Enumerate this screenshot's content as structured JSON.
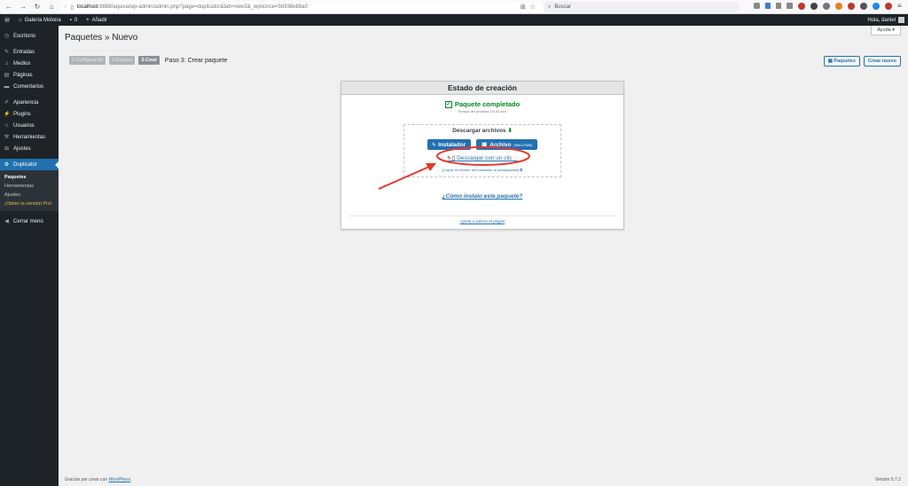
{
  "browser": {
    "url_host": "localhost",
    "url_path": ":8888/aquiva/wp-admin/admin.php?page=duplicator&tab=new3&_wpnonce=5b938eb9a0",
    "search_placeholder": "Buscar"
  },
  "adminbar": {
    "site_name": "Galería Molona",
    "comments_count": "0",
    "add_label": "Añadir",
    "greeting": "Hola, daniel"
  },
  "sidebar": {
    "items": [
      {
        "icon": "dashboard-icon",
        "label": "Escritorio"
      },
      {
        "icon": "pin-icon",
        "label": "Entradas"
      },
      {
        "icon": "media-icon",
        "label": "Medios"
      },
      {
        "icon": "page-icon",
        "label": "Páginas"
      },
      {
        "icon": "comment-icon",
        "label": "Comentarios"
      },
      {
        "icon": "brush-icon",
        "label": "Apariencia"
      },
      {
        "icon": "plugin-icon",
        "label": "Plugins"
      },
      {
        "icon": "users-icon",
        "label": "Usuarios"
      },
      {
        "icon": "tools-icon",
        "label": "Herramientas"
      },
      {
        "icon": "settings-icon",
        "label": "Ajustes"
      },
      {
        "icon": "duplicator-icon",
        "label": "Duplicator"
      }
    ],
    "submenu": [
      "Paquetes",
      "Herramientas",
      "Ajustes",
      "¡Obtén la versión Pro!"
    ],
    "collapse": "Cerrar menú"
  },
  "header": {
    "help": "Ayuda ▾",
    "title": "Paquetes » Nuevo"
  },
  "steps": {
    "s1": "1-Configuración",
    "s2": "2-Explorar",
    "s3": "3-Crear",
    "label": "Paso 3: Crear paquete"
  },
  "top_buttons": {
    "packages": "Paquetes",
    "new": "Crear nuevo"
  },
  "panel": {
    "title": "Estado de creación",
    "status": "Paquete completado",
    "time": "Tiempo del proceso: 00.33 sec.",
    "download_title": "Descargar archivos",
    "installer_btn": "Instalador",
    "archive_btn": "Archivo",
    "archive_size": "(598.07MB)",
    "one_click": "Descargar con un clic",
    "copy_name": "[Copiar el nombre del instalador al portapapeles]",
    "howto": "¿Cómo instalo este paquete?",
    "rate": "Ayuda a valorar el plugin!"
  },
  "footer": {
    "thanks_prefix": "Gracias por crear con",
    "wp_link": "WordPress",
    "version": "Versión 5.7.2"
  },
  "colors": {
    "accent": "#2271b1",
    "success": "#008a20",
    "annotation": "#e8372b"
  }
}
